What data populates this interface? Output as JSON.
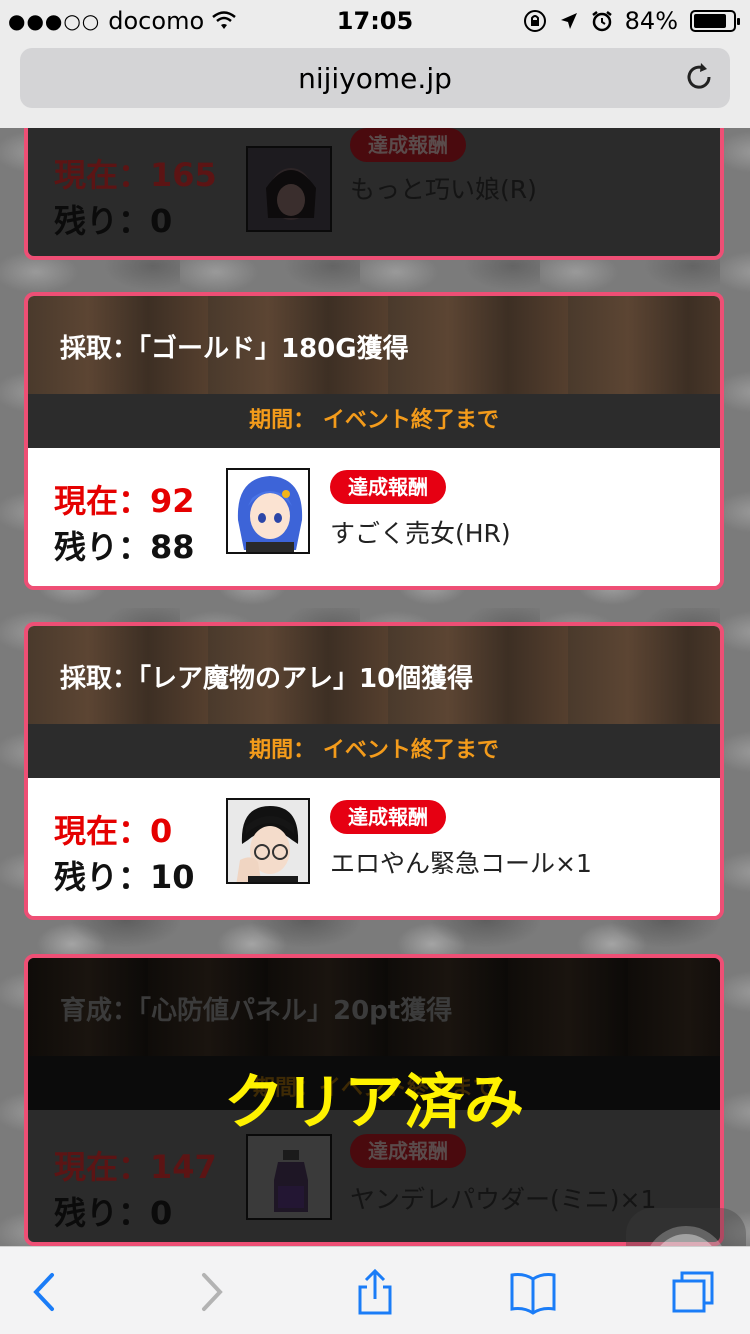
{
  "statusbar": {
    "carrier": "docomo",
    "signal": "●●●○○",
    "time": "17:05",
    "battery": "84%",
    "battery_level": 0.84
  },
  "browser": {
    "url": "nijiyome.jp"
  },
  "cards": {
    "top_partial": {
      "current": "現在：165",
      "remain": "残り：0",
      "badge": "達成報酬",
      "reward": "もっと巧い娘(R)"
    },
    "gold": {
      "title": "採取：「ゴールド」180G獲得",
      "period": "期間：  イベント終了まで",
      "current": "現在：92",
      "remain": "残り：88",
      "badge": "達成報酬",
      "reward": "すごく売女(HR)"
    },
    "rare": {
      "title": "採取：「レア魔物のアレ」10個獲得",
      "period": "期間：  イベント終了まで",
      "current": "現在：0",
      "remain": "残り：10",
      "badge": "達成報酬",
      "reward": "エロやん緊急コール×1"
    },
    "panel": {
      "title": "育成：「心防値パネル」20pt獲得",
      "period": "期間：イベント終了まで",
      "current": "現在：147",
      "remain": "残り：0",
      "badge": "達成報酬",
      "reward": "ヤンデレパウダー(ミニ)×1",
      "cleared_label": "クリア済み"
    }
  },
  "icons": {
    "back": "chevron-left-icon",
    "forward": "chevron-right-icon",
    "share": "share-icon",
    "bookmarks": "book-icon",
    "tabs": "tabs-icon",
    "reload": "reload-icon"
  },
  "colors": {
    "accent_border": "#ee4f75",
    "current_red": "#e50000",
    "period_orange": "#f39b1b",
    "badge_red": "#e60012",
    "cleared_yellow": "#fff200",
    "ios_blue": "#1a7cf7"
  }
}
